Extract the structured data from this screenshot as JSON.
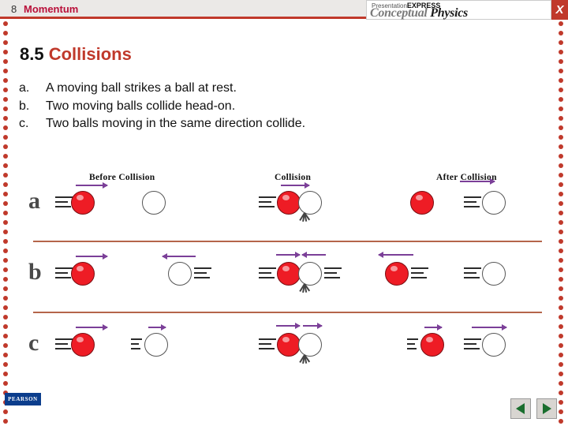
{
  "header": {
    "chapter_number": "8",
    "chapter_title": "Momentum",
    "logo_top": "Presentation",
    "logo_top_bold": "EXPRESS",
    "logo_main_a": "Conceptual",
    "logo_main_b": "Physics",
    "close_label": "X",
    "accent_color": "#c0392b",
    "title_color": "#b9103a"
  },
  "slide": {
    "number": "8.5",
    "title": "Collisions",
    "bullets": [
      {
        "label": "a.",
        "text": "A moving ball strikes a ball at rest."
      },
      {
        "label": "b.",
        "text": "Two moving balls collide head-on."
      },
      {
        "label": "c.",
        "text": "Two balls moving in the same direction collide."
      }
    ]
  },
  "figure": {
    "column_headings": [
      "Before Collision",
      "Collision",
      "After Collision"
    ],
    "row_labels": [
      "a",
      "b",
      "c"
    ],
    "rows": [
      {
        "label": "a",
        "before": "red ball moving right toward white ball at rest",
        "collision": "red ball contacts white ball, burst lines",
        "after": "red ball at rest, white ball moving right"
      },
      {
        "label": "b",
        "before": "red ball moving right, white ball moving left",
        "collision": "red and white balls contact head-on, burst lines",
        "after": "red ball moving left, white ball moving right"
      },
      {
        "label": "c",
        "before": "red ball moving right fast, white ball moving right slow",
        "collision": "red ball overtakes and contacts white ball",
        "after": "red ball moving right slow, white ball moving right fast"
      }
    ],
    "arrow_color": "#7b3f98",
    "divider_color": "#b5654a",
    "ball_red": "#ee1c25",
    "ball_white": "#ffffff"
  },
  "footer": {
    "publisher": "PEARSON",
    "prev_label": "previous-slide",
    "next_label": "next-slide"
  }
}
